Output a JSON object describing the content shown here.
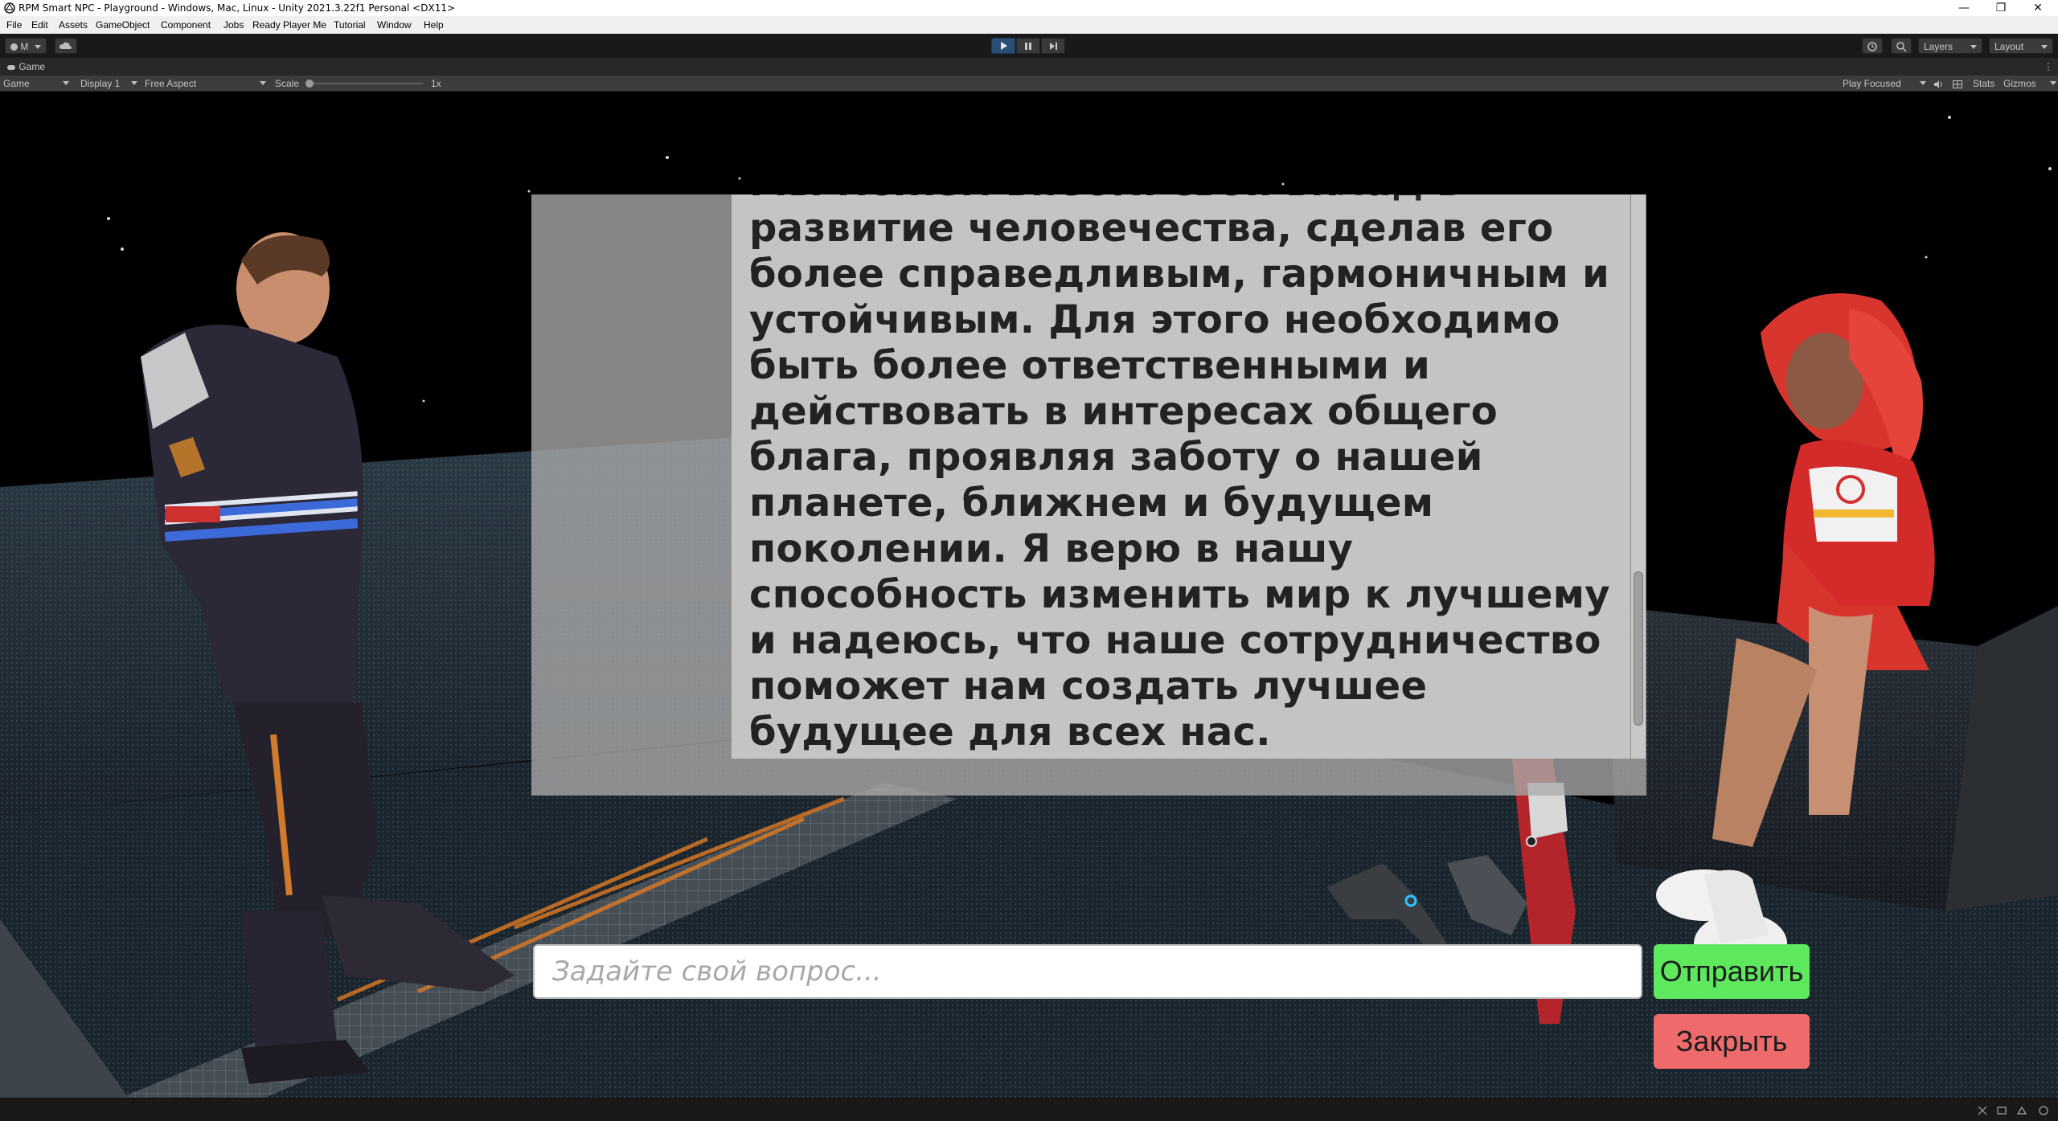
{
  "window": {
    "title": "RPM Smart NPC - Playground - Windows, Mac, Linux - Unity 2021.3.22f1 Personal <DX11>",
    "minimize_glyph": "—",
    "maximize_glyph": "❐",
    "close_glyph": "✕"
  },
  "menu": {
    "items": [
      "File",
      "Edit",
      "Assets",
      "GameObject",
      "Component",
      "Jobs",
      "Ready Player Me",
      "Tutorial",
      "Window",
      "Help"
    ]
  },
  "toolbar": {
    "account_label": "M",
    "layers_label": "Layers",
    "layout_label": "Layout",
    "colors": {
      "play_active": "#2a4f75"
    }
  },
  "game_view": {
    "tab_label": "Game",
    "mode_label": "Game",
    "display_label": "Display 1",
    "aspect_label": "Free Aspect",
    "scale_label": "Scale",
    "scale_value": "1x",
    "scale_fraction": 0.0,
    "play_focused_label": "Play Focused",
    "stats_label": "Stats",
    "gizmos_label": "Gizmos"
  },
  "chat": {
    "answer_text": "окружающих и наш будущий мир. Мы можем внести свой вклад в развитие человечества, сделав его более справедливым, гармоничным и устойчивым. Для этого необходимо быть более ответственными и действовать в интересах общего блага, проявляя заботу о нашей планете, ближнем и будущем поколении. Я верю в нашу способность изменить мир к лучшему и надеюсь, что наше сотрудничество поможет нам создать лучшее будущее для всех нас.",
    "input_placeholder": "Задайте свой вопрос...",
    "input_value": "",
    "send_label": "Отправить",
    "close_label": "Закрыть",
    "scroll_position": 0.93,
    "colors": {
      "send": "#5ee85e",
      "close": "#ef6b6b",
      "panel": "#aaaaaa"
    }
  }
}
